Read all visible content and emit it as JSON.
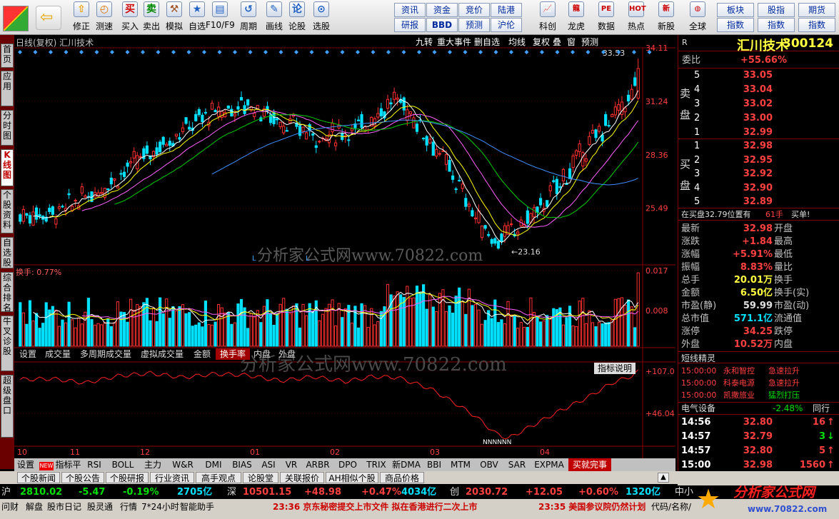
{
  "toolbar": {
    "items": [
      {
        "label": "修正",
        "icon": "arrow-up-icon"
      },
      {
        "label": "测速",
        "icon": "clock-icon"
      },
      {
        "label": "买入",
        "icon": "buy-icon"
      },
      {
        "label": "卖出",
        "icon": "sell-icon"
      },
      {
        "label": "模拟",
        "icon": "hammer-icon"
      },
      {
        "label": "自选",
        "icon": "star-icon"
      },
      {
        "label": "F10/F9",
        "icon": "f10-icon"
      },
      {
        "label": "周期",
        "icon": "cycle-icon"
      },
      {
        "label": "画线",
        "icon": "pencil-icon"
      },
      {
        "label": "论股",
        "icon": "talk-icon"
      },
      {
        "label": "选股",
        "icon": "select-icon"
      }
    ],
    "small": [
      [
        "资讯",
        "研报"
      ],
      [
        "资金",
        "BBD"
      ],
      [
        "竞价",
        "预测"
      ],
      [
        "陆港",
        "沪伦"
      ]
    ],
    "icons2": [
      {
        "label": "科创",
        "icon": "chart-icon"
      },
      {
        "label": "龙虎",
        "icon": "dragon-icon"
      },
      {
        "label": "数据",
        "icon": "pe-icon"
      },
      {
        "label": "热点",
        "icon": "hot-icon"
      },
      {
        "label": "新股",
        "icon": "ipo-icon"
      },
      {
        "label": "全球",
        "icon": "globe-icon"
      }
    ],
    "small2": [
      [
        "板块",
        "指数"
      ],
      [
        "股指",
        "指数"
      ],
      [
        "期货",
        "指数"
      ]
    ]
  },
  "sidetabs": [
    "首页",
    "应用",
    "分时图",
    "K线图",
    "个股资料",
    "自选股",
    "综合排名",
    "牛叉诊股",
    "超级盘口"
  ],
  "chart_header": {
    "title": "日线(复权) 汇川技术",
    "buttons": [
      "九转",
      "重大事件",
      "删自选",
      "均线",
      "复权",
      "叠",
      "窗",
      "预测"
    ]
  },
  "chart_data": {
    "type": "candlestick",
    "ylim": [
      22.6,
      34.11
    ],
    "yticks": [
      "34.11",
      "31.24",
      "28.36",
      "25.49"
    ],
    "high_label": "33.53",
    "low_label": "23.16",
    "high": 33.53,
    "low": 23.16,
    "months": [
      "10",
      "11",
      "12",
      "01",
      "02",
      "03",
      "04"
    ],
    "watermark": "分析家公式网www.70822.com",
    "vol_title": "换手: 0.77%",
    "vol_ticks": [
      "0.017",
      "0.008"
    ],
    "vol_max": 0.017,
    "ind_ticks": [
      "+107.0",
      "+46.04"
    ],
    "ind_range": [
      0,
      112
    ],
    "ind_min_label": "NNNNNN",
    "ohlc_note": "close price sequence"
  },
  "vol_tabs": [
    "设置",
    "成交量",
    "多周期成交量",
    "虚拟成交量",
    "金额",
    "换手率",
    "内盘",
    "外盘"
  ],
  "ind_btn": "指标说明",
  "right": {
    "name": "汇川技术",
    "code": "300124",
    "wb_label": "委比",
    "wb": "+55.66%",
    "sell_label": "卖盘",
    "sells": [
      [
        "5",
        "33.05"
      ],
      [
        "4",
        "33.04"
      ],
      [
        "3",
        "33.02"
      ],
      [
        "2",
        "33.00"
      ],
      [
        "1",
        "32.99"
      ]
    ],
    "buy_label": "买盘",
    "buys": [
      [
        "1",
        "32.98"
      ],
      [
        "2",
        "32.95"
      ],
      [
        "3",
        "32.92"
      ],
      [
        "4",
        "32.90"
      ],
      [
        "5",
        "32.89"
      ]
    ],
    "notice": "在买盘32.79位置有",
    "notice_n": "61手",
    "notice_b": "买单!",
    "stats": [
      [
        "最新",
        "32.98",
        "开盘"
      ],
      [
        "涨跌",
        "+1.84",
        "最高"
      ],
      [
        "涨幅",
        "+5.91%",
        "最低"
      ],
      [
        "振幅",
        "8.83%",
        "量比"
      ],
      [
        "总手",
        "20.01万",
        "换手"
      ],
      [
        "金额",
        "6.50亿",
        "换手(实)"
      ],
      [
        "市盈(静)",
        "59.99",
        "市盈(动)"
      ],
      [
        "总市值",
        "571.1亿",
        "流通值"
      ],
      [
        "涨停",
        "34.25",
        "跌停"
      ],
      [
        "外盘",
        "10.52万",
        "内盘"
      ]
    ],
    "elf_title": "短线精灵",
    "elf": [
      [
        "15:00:00",
        "永和智控",
        "急速拉升"
      ],
      [
        "15:00:00",
        "科泰电源",
        "急速拉升"
      ],
      [
        "15:00:00",
        "凯撒旅业",
        "猛烈打压"
      ]
    ],
    "sector": "电气设备",
    "sector_chg": "-2.48%",
    "sector_r": "同行",
    "ticks": [
      [
        "14:56",
        "32.80",
        "16"
      ],
      [
        "14:57",
        "32.79",
        "3"
      ],
      [
        "14:57",
        "32.80",
        "5"
      ],
      [
        "15:00",
        "32.98",
        "1560"
      ]
    ]
  },
  "bottom_tabs": [
    "设置",
    "指标平台",
    "RSI",
    "BOLL",
    "主力",
    "W&R",
    "DMI",
    "BIAS",
    "ASI",
    "VR",
    "ARBR",
    "DPO",
    "TRIX",
    "新DMA",
    "BBI",
    "MTM",
    "OBV",
    "SAR",
    "EXPMA",
    "买就完事"
  ],
  "news_tabs": [
    "个股新闻",
    "个股公告",
    "个股研报",
    "行业资讯",
    "高手观点",
    "论股堂",
    "关联报价",
    "AH相似个股",
    "商品价格"
  ],
  "status": [
    [
      "沪",
      "2810.02",
      "-5.47",
      "-0.19%",
      "2705亿"
    ],
    [
      "深",
      "10501.15",
      "+48.98",
      "+0.47%",
      "4034亿"
    ],
    [
      "创",
      "2030.72",
      "+12.05",
      "+0.60%",
      "1320亿"
    ]
  ],
  "status_tail": "中小",
  "bottombar": {
    "items": [
      "问财",
      "解盘",
      "股市日记",
      "股灵通",
      "行情",
      "7*24小时",
      "智能助手"
    ],
    "news1": "23:36 京东秘密提交上市文件 拟在香港进行二次上市",
    "news2": "23:35 美国参议院仍然计划",
    "right": "代码/名称/",
    "logo": "分析家公式网",
    "logo_url": "www.70822.com"
  }
}
